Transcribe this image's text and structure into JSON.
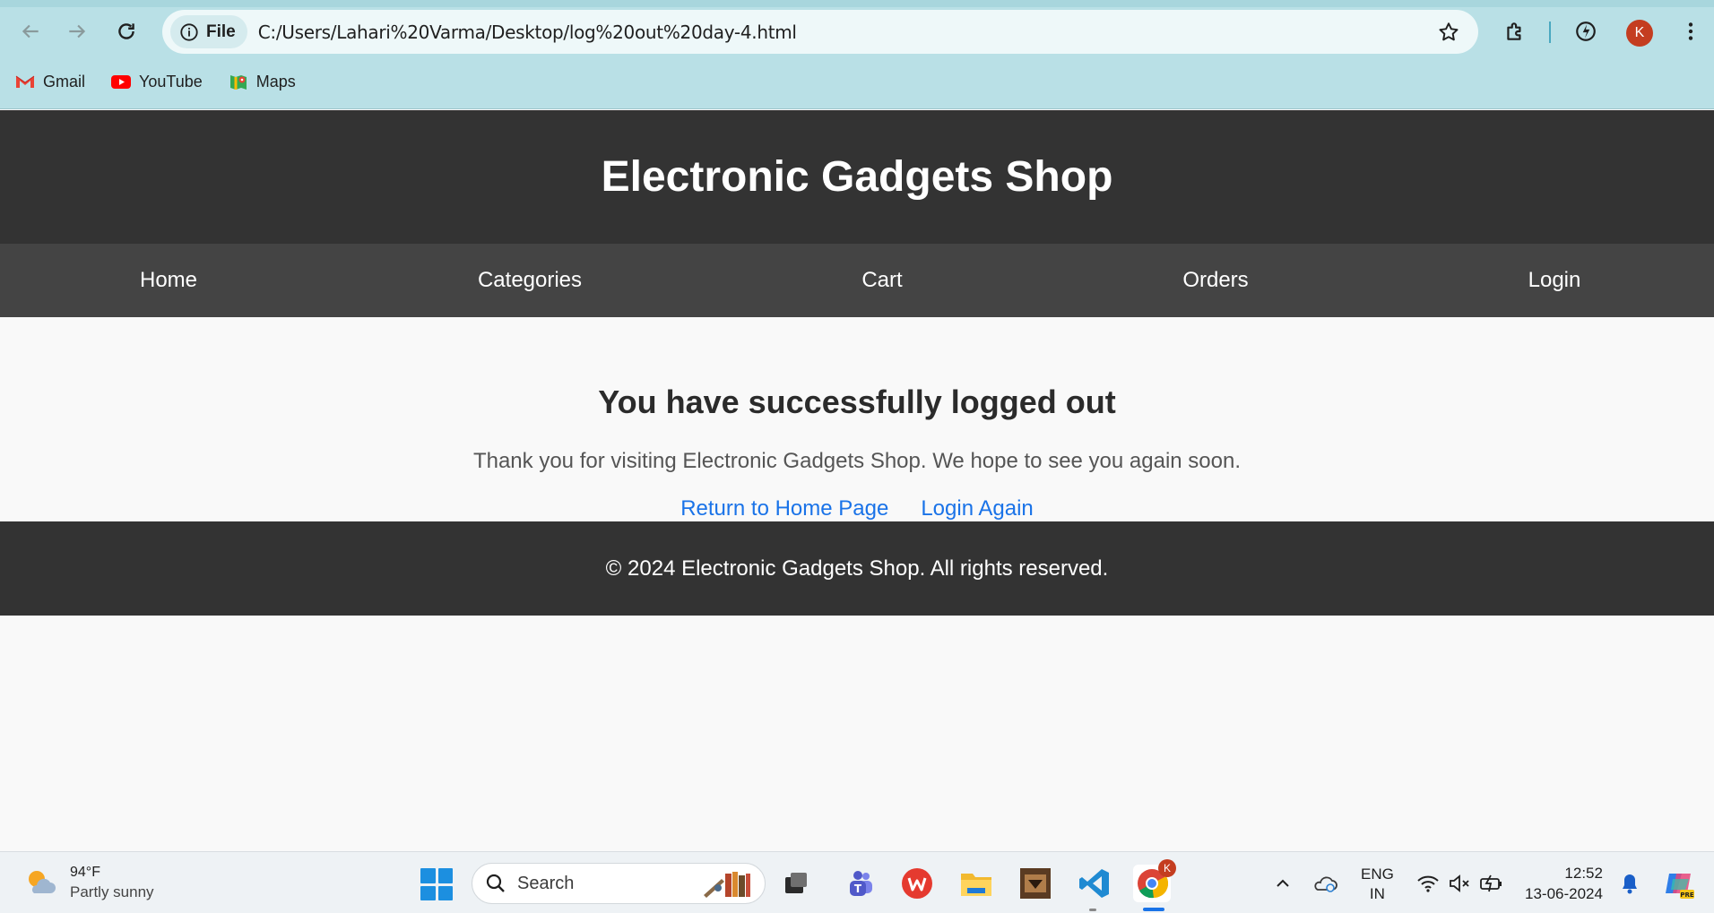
{
  "browser": {
    "site_chip": "File",
    "url": "C:/Users/Lahari%20Varma/Desktop/log%20out%20day-4.html",
    "profile_initial": "K",
    "bookmarks": [
      {
        "label": "Gmail",
        "icon": "gmail-icon"
      },
      {
        "label": "YouTube",
        "icon": "youtube-icon"
      },
      {
        "label": "Maps",
        "icon": "maps-icon"
      }
    ]
  },
  "page": {
    "title": "Electronic Gadgets Shop",
    "nav": [
      "Home",
      "Categories",
      "Cart",
      "Orders",
      "Login"
    ],
    "heading": "You have successfully logged out",
    "message": "Thank you for visiting Electronic Gadgets Shop. We hope to see you again soon.",
    "links": {
      "home": "Return to Home Page",
      "login": "Login Again"
    },
    "footer": "© 2024 Electronic Gadgets Shop. All rights reserved.",
    "colors": {
      "header_bg": "#333333",
      "nav_bg": "#444444",
      "link": "#1a73e8"
    }
  },
  "taskbar": {
    "weather": {
      "temp": "94°F",
      "condition": "Partly sunny"
    },
    "search_label": "Search",
    "lang": {
      "line1": "ENG",
      "line2": "IN"
    },
    "clock": {
      "time": "12:52",
      "date": "13-06-2024"
    },
    "chrome_badge": "K"
  }
}
